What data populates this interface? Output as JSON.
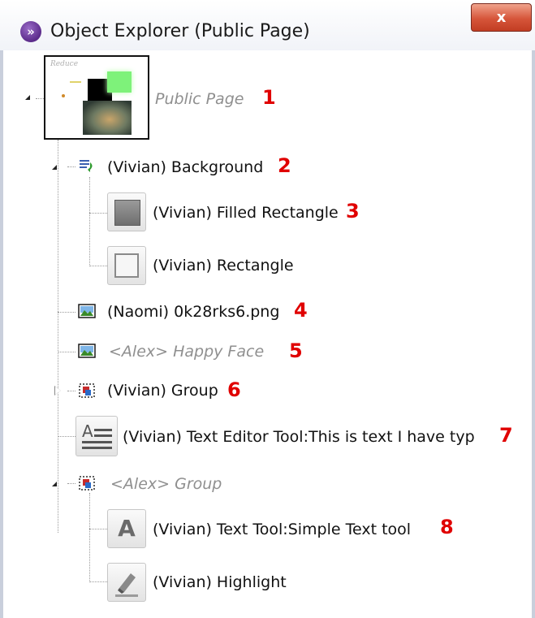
{
  "window": {
    "title": "Object Explorer (Public Page)",
    "close_glyph": "x",
    "app_icon": "chevron-badge-icon"
  },
  "colors": {
    "annotation_number": "#e00000",
    "muted_text": "#8f8f8f",
    "close_button": "#d6553a"
  },
  "tree": {
    "root": {
      "label": "Public Page",
      "annotation": "1",
      "thumb_label": "Reduce"
    },
    "items": {
      "background": {
        "label": "(Vivian) Background",
        "annotation": "2",
        "icon": "layer-arrow-icon"
      },
      "filled_rect": {
        "label": "(Vivian) Filled Rectangle",
        "annotation": "3",
        "icon": "filled-rectangle-icon"
      },
      "rect": {
        "label": "(Vivian) Rectangle",
        "annotation": "",
        "icon": "rectangle-icon"
      },
      "png": {
        "label": "(Naomi) 0k28rks6.png",
        "annotation": "4",
        "icon": "image-icon"
      },
      "happy_face": {
        "label": "<Alex> Happy Face",
        "annotation": "5",
        "icon": "image-icon"
      },
      "group1": {
        "label": "(Vivian) Group",
        "annotation": "6",
        "icon": "group-icon"
      },
      "text_editor": {
        "label": "(Vivian) Text Editor Tool:This is text I have typ",
        "annotation": "7",
        "icon": "text-editor-icon"
      },
      "group2": {
        "label": "<Alex> Group",
        "annotation": "",
        "icon": "group-icon"
      },
      "text_tool": {
        "label": "(Vivian) Text Tool:Simple Text tool",
        "annotation": "8",
        "icon": "text-tool-icon"
      },
      "highlight": {
        "label": "(Vivian) Highlight",
        "annotation": "",
        "icon": "highlighter-icon"
      }
    }
  }
}
